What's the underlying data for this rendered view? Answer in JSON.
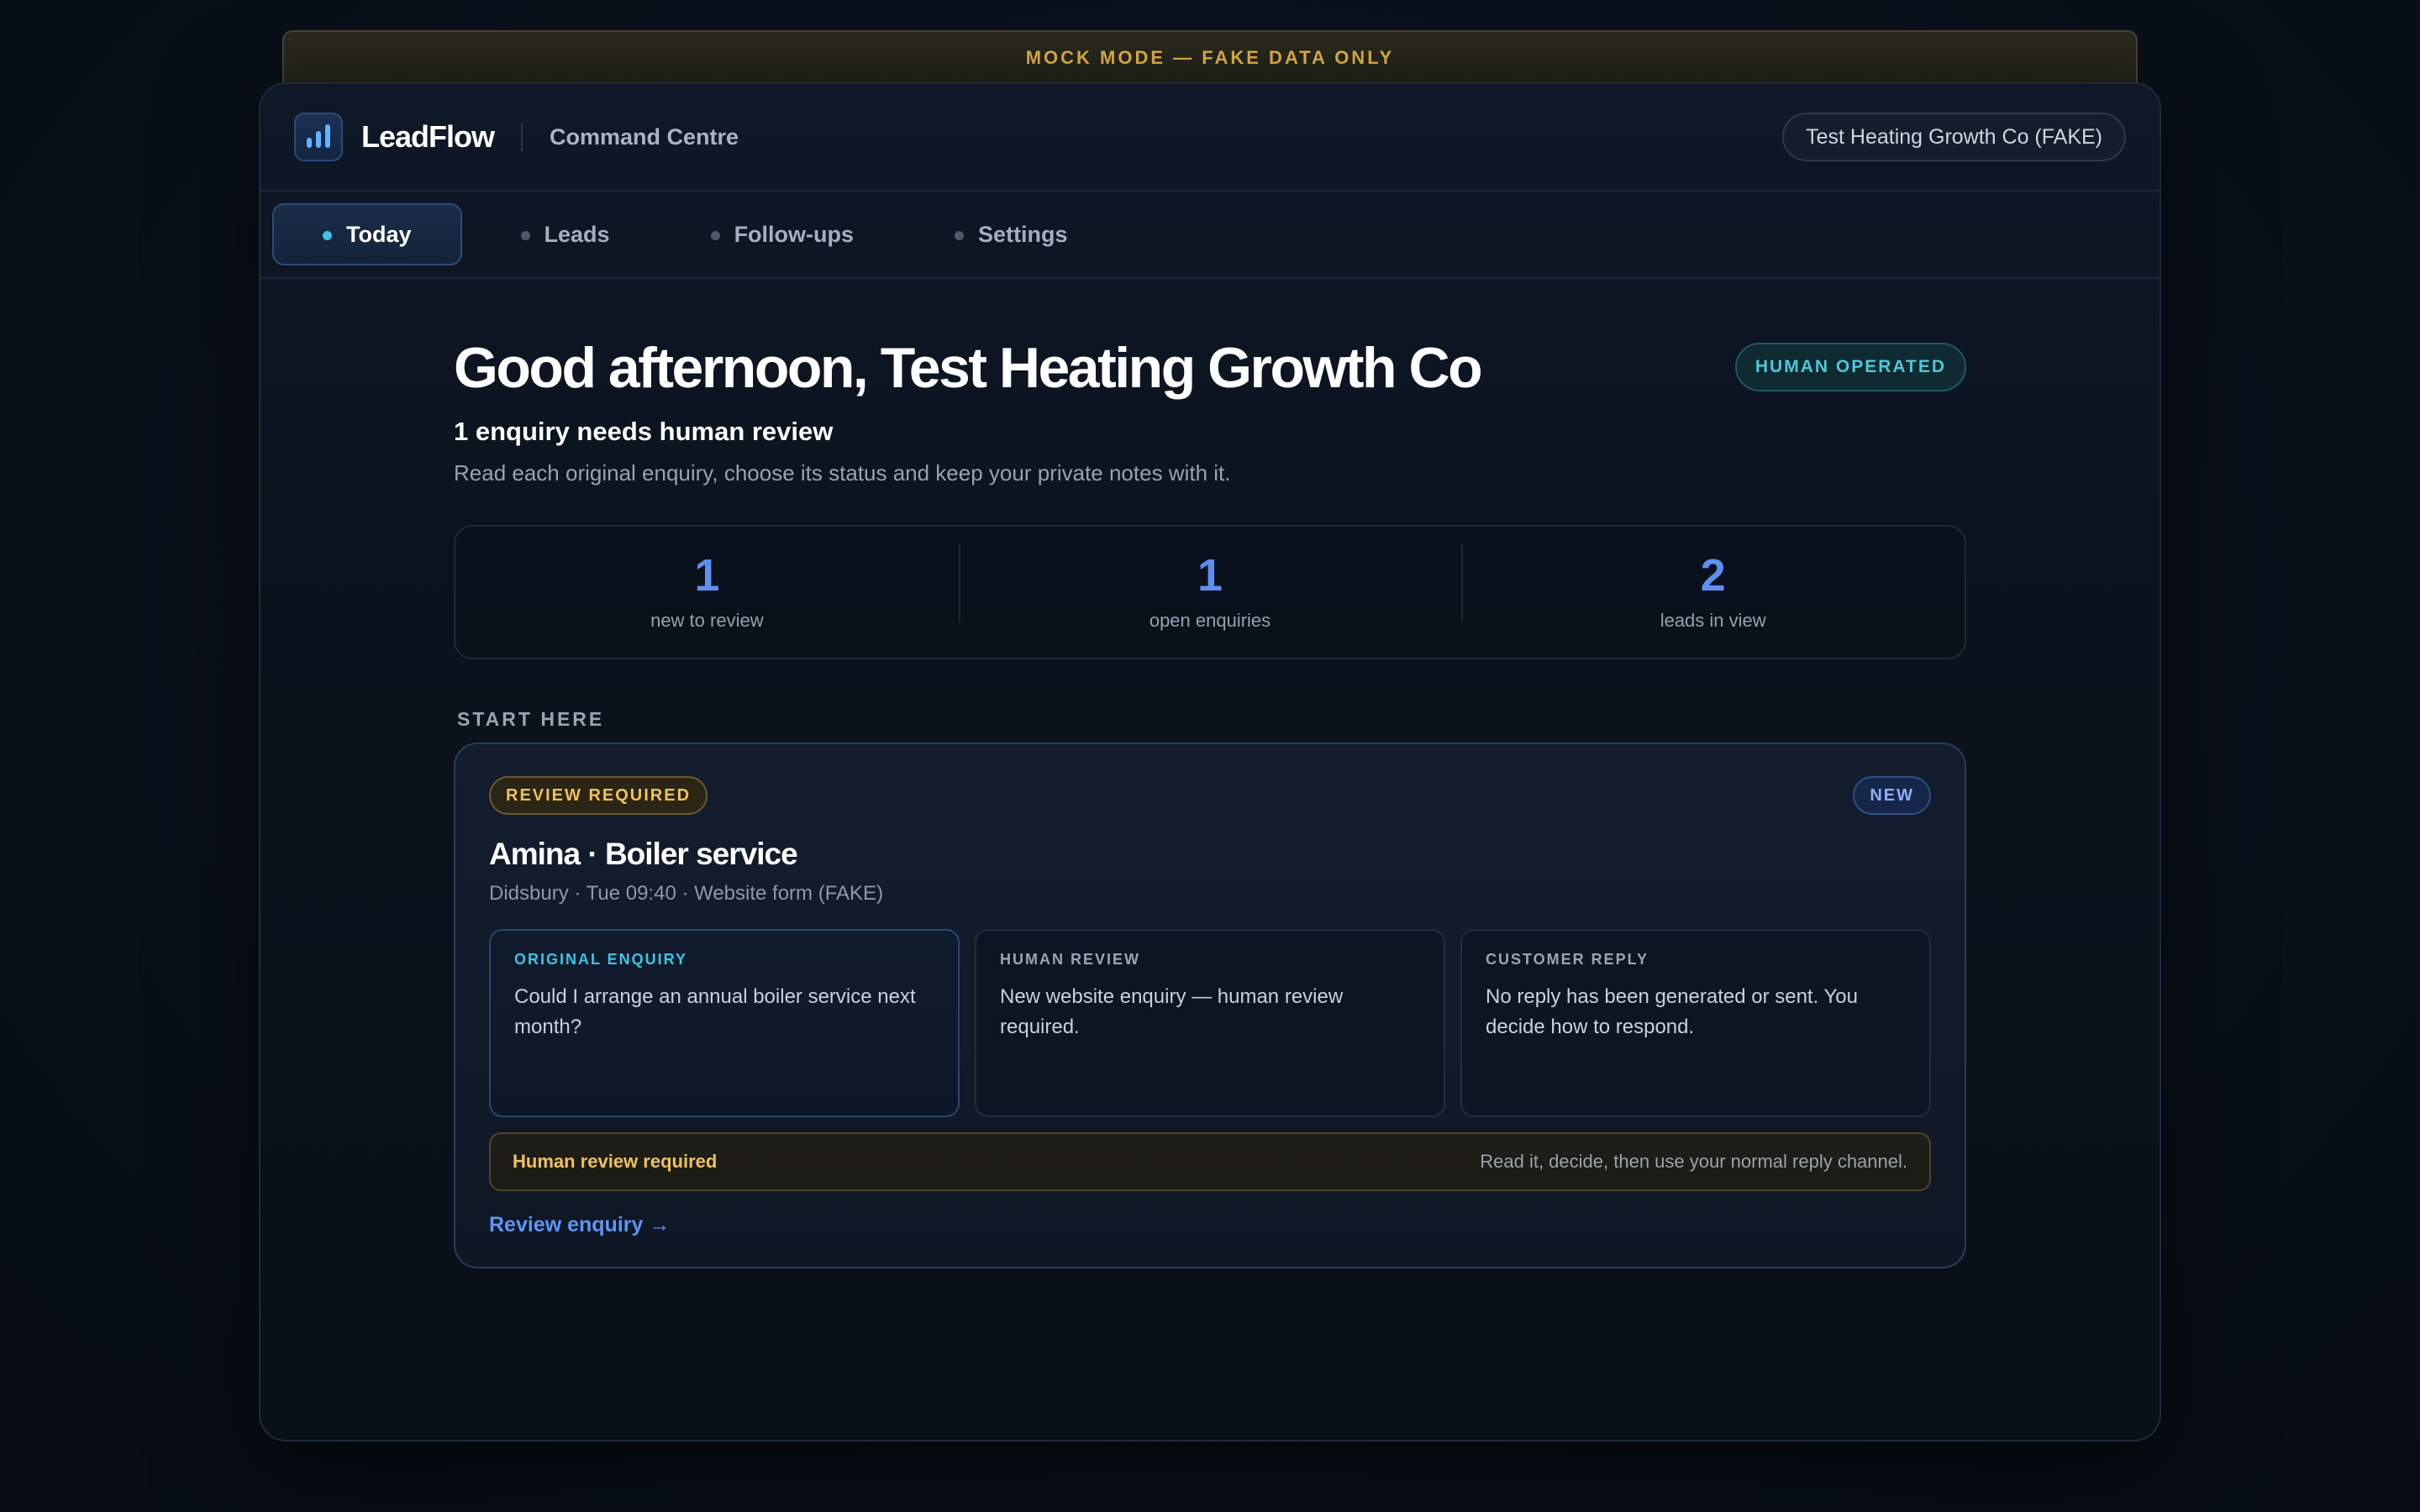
{
  "banner": {
    "text": "MOCK MODE — FAKE DATA ONLY"
  },
  "header": {
    "brand": "LeadFlow",
    "subtitle": "Command Centre",
    "org": "Test Heating Growth Co (FAKE)"
  },
  "nav": {
    "tabs": [
      {
        "label": "Today",
        "active": true
      },
      {
        "label": "Leads",
        "active": false
      },
      {
        "label": "Follow-ups",
        "active": false
      },
      {
        "label": "Settings",
        "active": false
      }
    ]
  },
  "main": {
    "greeting": "Good afternoon, Test Heating Growth Co",
    "mode_badge": "HUMAN OPERATED",
    "summary": "1 enquiry needs human review",
    "description": "Read each original enquiry, choose its status and keep your private notes with it.",
    "stats": [
      {
        "value": "1",
        "label": "new to review"
      },
      {
        "value": "1",
        "label": "open enquiries"
      },
      {
        "value": "2",
        "label": "leads in view"
      }
    ],
    "section_label": "START HERE",
    "card": {
      "status_badge": "REVIEW REQUIRED",
      "new_badge": "NEW",
      "title": "Amina · Boiler service",
      "meta": "Didsbury · Tue 09:40 · Website form (FAKE)",
      "panels": [
        {
          "label": "ORIGINAL ENQUIRY",
          "text": "Could I arrange an annual boiler service next month?"
        },
        {
          "label": "HUMAN REVIEW",
          "text": "New website enquiry — human review required."
        },
        {
          "label": "CUSTOMER REPLY",
          "text": "No reply has been generated or sent. You decide how to respond."
        }
      ],
      "alert_title": "Human review required",
      "alert_text": "Read it, decide, then use your normal reply channel.",
      "action_link": "Review enquiry →"
    }
  },
  "colors": {
    "accent_blue": "#5e8ff0",
    "accent_cyan": "#3cc4e6",
    "warning_amber": "#f0c25a",
    "background": "#0a111c"
  },
  "icons": {
    "logo": "bar-chart-icon"
  }
}
